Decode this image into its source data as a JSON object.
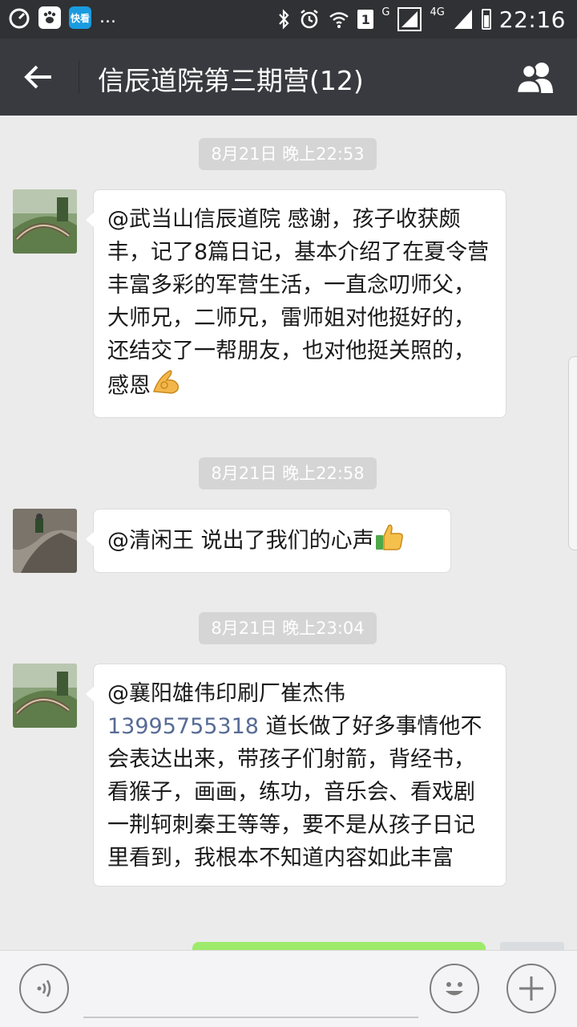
{
  "status_bar": {
    "time": "22:16",
    "app_badge": "1",
    "network_label": "G",
    "network_label_2": "4G",
    "more_indicator": "...",
    "news_app_text": "快看"
  },
  "header": {
    "title": "信辰道院第三期营(12)"
  },
  "messages": [
    {
      "timestamp": "8月21日 晚上22:53",
      "text": "@武当山信辰道院 感谢，孩子收获颇丰，记了8篇日记，基本介绍了在夏令营丰富多彩的军营生活，一直念叨师父，大师兄，二师兄，雷师姐对他挺好的，还结交了一帮朋友，也对他挺关照的，感恩"
    },
    {
      "timestamp": "8月21日 晚上22:58",
      "text": "@清闲王 说出了我们的心声"
    },
    {
      "timestamp": "8月21日 晚上23:04",
      "text_before": "@襄阳雄伟印刷厂崔杰伟",
      "phone": "13995755318",
      "text_after": " 道长做了好多事情他不会表达出来，带孩子们射箭，背经书，看猴子，画画，练功，音乐会、看戏剧一荆轲刺秦王等等，要不是从孩子日记里看到，我根本不知道内容如此丰富"
    }
  ],
  "colors": {
    "title_bar": "#393a3f",
    "status_bar": "#2f3134",
    "chat_bg": "#ebebeb",
    "link": "#576b95",
    "self_bubble": "#9eea6a"
  }
}
